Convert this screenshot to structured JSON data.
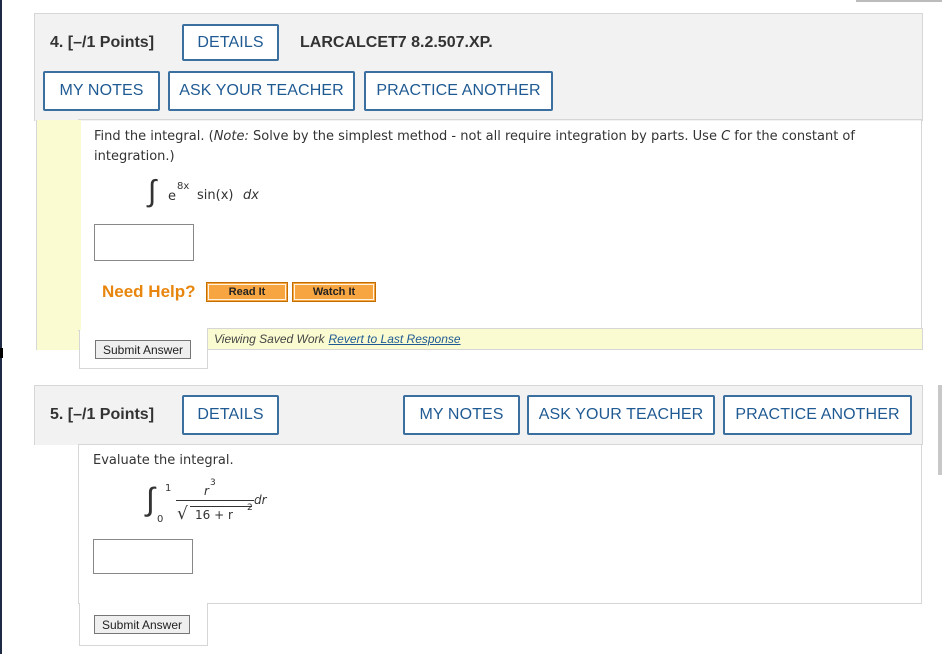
{
  "q4": {
    "title": "4. [–/1 Points]",
    "details": "DETAILS",
    "code": "LARCALCET7 8.2.507.XP.",
    "my_notes": "MY NOTES",
    "ask_teacher": "ASK YOUR TEACHER",
    "practice": "PRACTICE ANOTHER",
    "prompt_a": "Find the integral. (",
    "prompt_note": "Note:",
    "prompt_b": " Solve by the simplest method - not all require integration by parts. Use ",
    "prompt_c": "C",
    "prompt_d": " for the constant of integration.)",
    "integral_sign": "∫",
    "base": "e",
    "exponent": "8x",
    "integrand_rest": "sin(x) ",
    "dx": "dx",
    "answer_value": "",
    "need_help": "Need Help?",
    "read_it": "Read It",
    "watch_it": "Watch It",
    "submit": "Submit Answer",
    "saved_text": "Viewing Saved Work",
    "revert_link": "Revert to Last Response"
  },
  "q5": {
    "title": "5. [–/1 Points]",
    "details": "DETAILS",
    "my_notes": "MY NOTES",
    "ask_teacher": "ASK YOUR TEACHER",
    "practice": "PRACTICE ANOTHER",
    "prompt": "Evaluate the integral.",
    "integral_sign": "∫",
    "upper": "1",
    "lower": "0",
    "numerator": "r",
    "num_exp": "3",
    "sqrt_sign": "√",
    "denom_a": "16 + r",
    "denom_exp": "2",
    "dr": "dr",
    "answer_value": "",
    "submit": "Submit Answer"
  }
}
